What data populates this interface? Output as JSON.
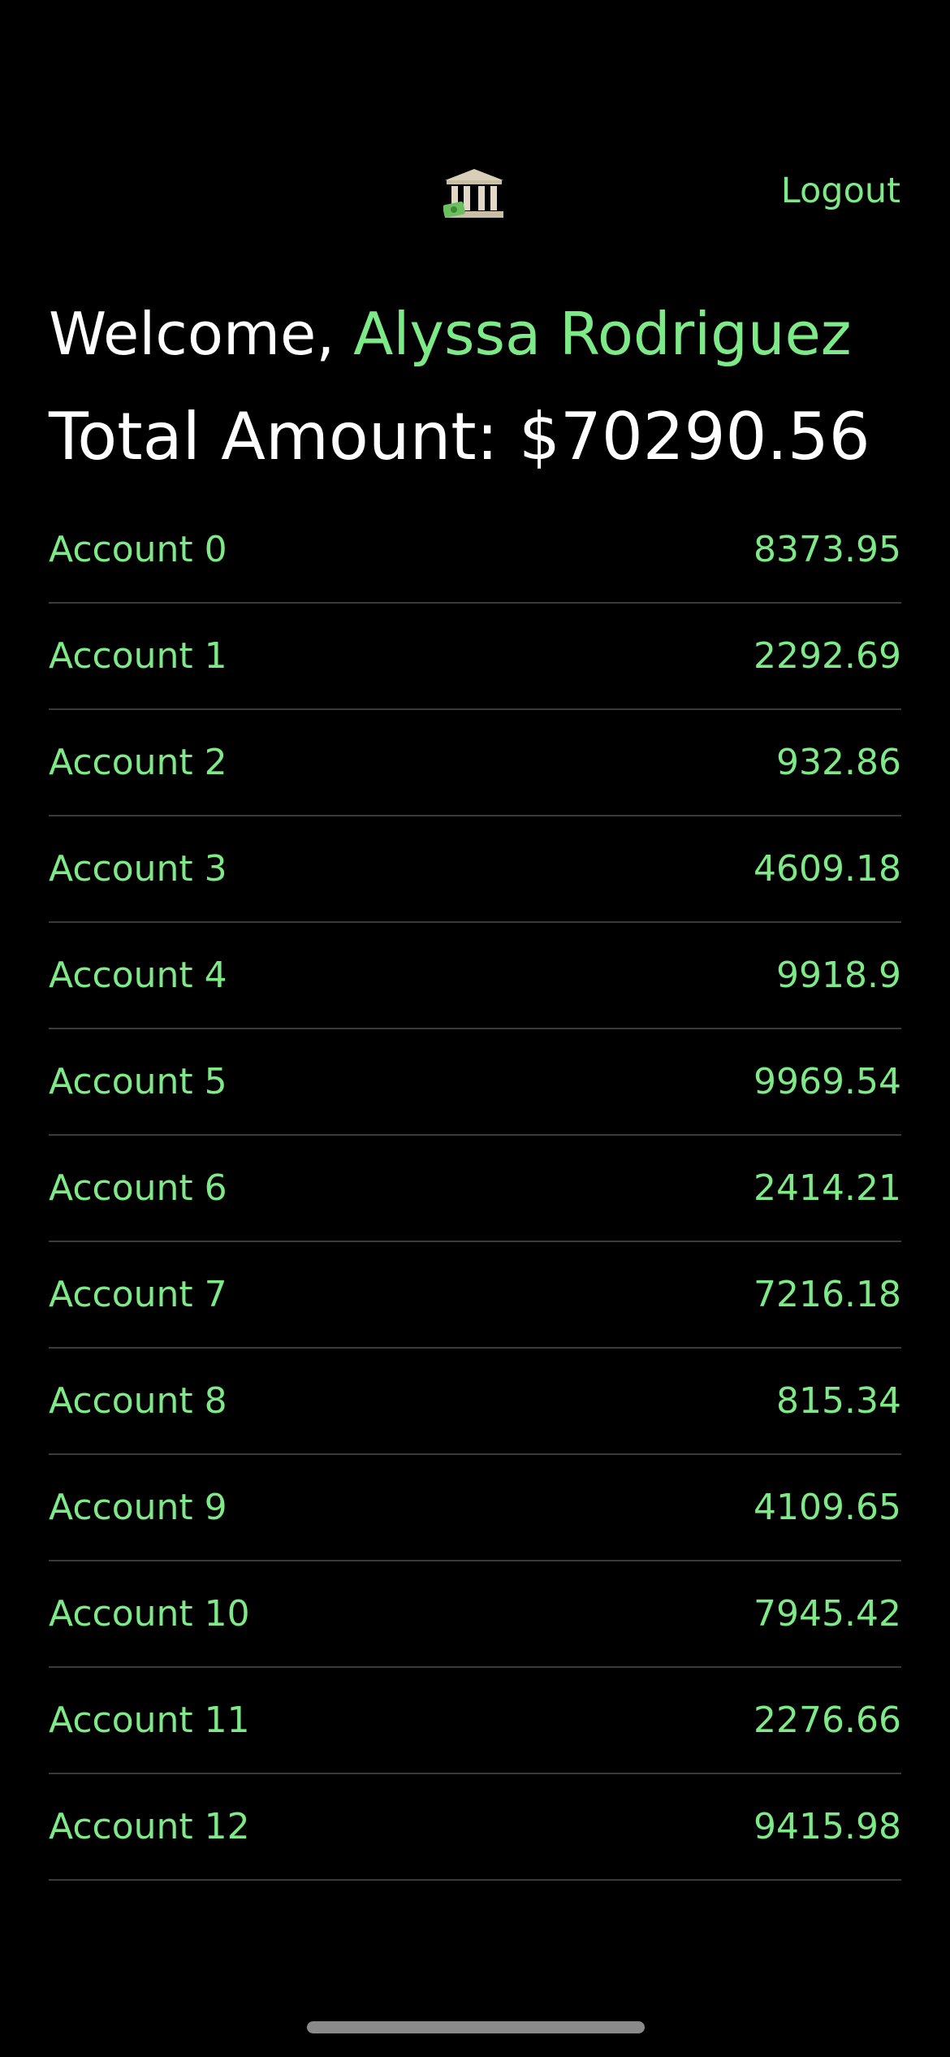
{
  "header": {
    "logo_icon": "bank-icon",
    "logout_label": "Logout"
  },
  "welcome": {
    "prefix": "Welcome, ",
    "name": "Alyssa Rodriguez"
  },
  "total": {
    "label": "Total Amount: $70290.56"
  },
  "accounts": [
    {
      "name": "Account 0",
      "amount": "8373.95"
    },
    {
      "name": "Account 1",
      "amount": "2292.69"
    },
    {
      "name": "Account 2",
      "amount": "932.86"
    },
    {
      "name": "Account 3",
      "amount": "4609.18"
    },
    {
      "name": "Account 4",
      "amount": "9918.9"
    },
    {
      "name": "Account 5",
      "amount": "9969.54"
    },
    {
      "name": "Account 6",
      "amount": "2414.21"
    },
    {
      "name": "Account 7",
      "amount": "7216.18"
    },
    {
      "name": "Account 8",
      "amount": "815.34"
    },
    {
      "name": "Account 9",
      "amount": "4109.65"
    },
    {
      "name": "Account 10",
      "amount": "7945.42"
    },
    {
      "name": "Account 11",
      "amount": "2276.66"
    },
    {
      "name": "Account 12",
      "amount": "9415.98"
    }
  ],
  "colors": {
    "background": "#000000",
    "accent": "#7ee987",
    "text": "#ffffff",
    "divider": "#3a3a3a"
  }
}
